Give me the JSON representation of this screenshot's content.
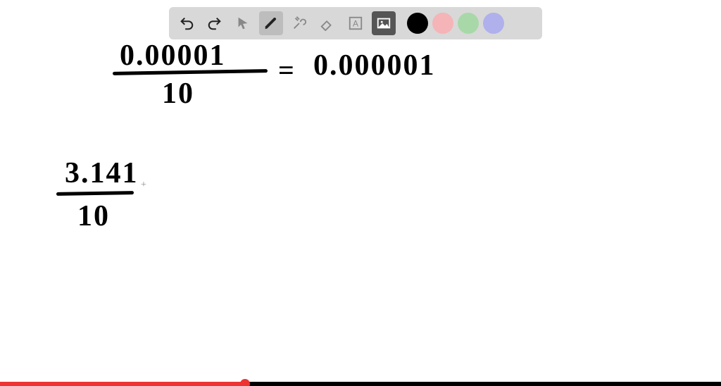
{
  "toolbar": {
    "undo": "undo",
    "redo": "redo",
    "pointer": "pointer",
    "pen": "pen",
    "tools": "tools",
    "eraser": "eraser",
    "text": "text",
    "image": "image",
    "colors": {
      "black": "#000000",
      "pink": "#f4b4b8",
      "green": "#a8d8a8",
      "purple": "#b0b0ec"
    },
    "selected_tool": "pen",
    "selected_color": "black"
  },
  "equation1": {
    "numerator": "0.00001",
    "denominator": "10",
    "equals": "=",
    "result": "0.000001"
  },
  "equation2": {
    "numerator": "3.141",
    "denominator": "10",
    "cursor": "+"
  },
  "player": {
    "progress_percent": 34
  }
}
